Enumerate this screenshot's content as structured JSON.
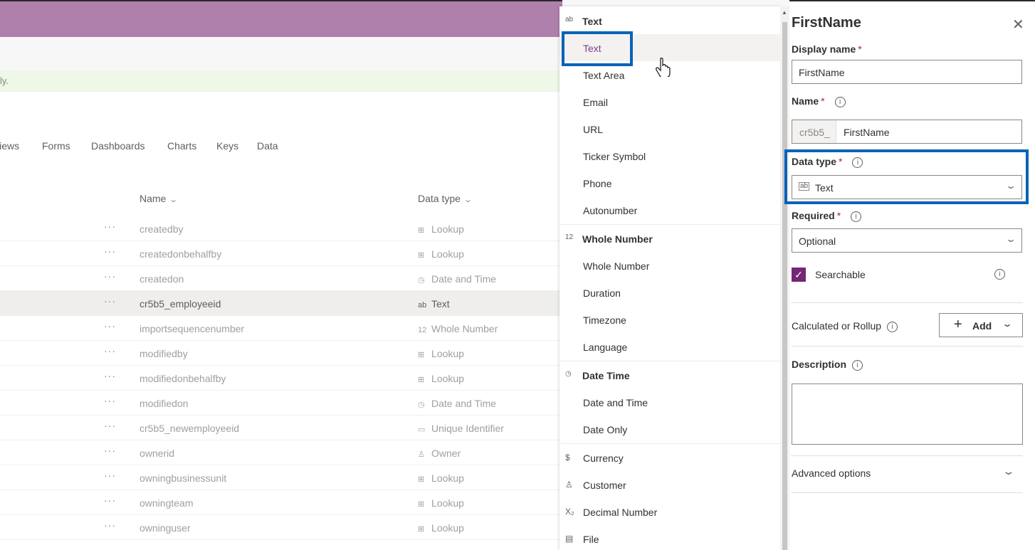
{
  "background": {
    "notice_text": "ly.",
    "tabs": [
      "Views",
      "Forms",
      "Dashboards",
      "Charts",
      "Keys",
      "Data"
    ],
    "columns": {
      "name": "Name",
      "data_type": "Data type"
    },
    "rows": [
      {
        "name": "createdby",
        "type": "Lookup",
        "icon": "lookup-icon"
      },
      {
        "name": "createdonbehalfby",
        "type": "Lookup",
        "icon": "lookup-icon"
      },
      {
        "name": "createdon",
        "type": "Date and Time",
        "icon": "datetime-icon"
      },
      {
        "name": "cr5b5_employeeid",
        "type": "Text",
        "icon": "text-icon"
      },
      {
        "name": "importsequencenumber",
        "type": "Whole Number",
        "icon": "number-icon"
      },
      {
        "name": "modifiedby",
        "type": "Lookup",
        "icon": "lookup-icon"
      },
      {
        "name": "modifiedonbehalfby",
        "type": "Lookup",
        "icon": "lookup-icon"
      },
      {
        "name": "modifiedon",
        "type": "Date and Time",
        "icon": "datetime-icon"
      },
      {
        "name": "cr5b5_newemployeeid",
        "type": "Unique Identifier",
        "icon": "uid-icon"
      },
      {
        "name": "ownerid",
        "type": "Owner",
        "icon": "person-icon"
      },
      {
        "name": "owningbusinessunit",
        "type": "Lookup",
        "icon": "lookup-icon"
      },
      {
        "name": "owningteam",
        "type": "Lookup",
        "icon": "lookup-icon"
      },
      {
        "name": "owninguser",
        "type": "Lookup",
        "icon": "lookup-icon"
      }
    ]
  },
  "dropdown": {
    "groups": [
      {
        "label": "Text",
        "icon": "text-icon",
        "options": [
          "Text",
          "Text Area",
          "Email",
          "URL",
          "Ticker Symbol",
          "Phone",
          "Autonumber"
        ]
      },
      {
        "label": "Whole Number",
        "icon": "number-icon",
        "options": [
          "Whole Number",
          "Duration",
          "Timezone",
          "Language"
        ]
      },
      {
        "label": "Date Time",
        "icon": "datetime-icon",
        "options": [
          "Date and Time",
          "Date Only"
        ]
      }
    ],
    "standalone": [
      {
        "label": "Currency",
        "icon": "currency-icon"
      },
      {
        "label": "Customer",
        "icon": "person-icon"
      },
      {
        "label": "Decimal Number",
        "icon": "decimal-icon"
      },
      {
        "label": "File",
        "icon": "file-icon"
      }
    ],
    "highlighted": "Text"
  },
  "panel": {
    "title": "FirstName",
    "display_name_label": "Display name",
    "display_name_value": "FirstName",
    "name_label": "Name",
    "name_prefix": "cr5b5_",
    "name_value": "FirstName",
    "data_type_label": "Data type",
    "data_type_value": "Text",
    "required_label": "Required",
    "required_value": "Optional",
    "searchable_label": "Searchable",
    "calculated_label": "Calculated or Rollup",
    "add_label": "Add",
    "description_label": "Description",
    "advanced_label": "Advanced options",
    "required_marker": "*",
    "info_glyph": "i"
  },
  "colors": {
    "accent": "#742774",
    "highlight_box": "#0a63b8",
    "header_band": "#b080ad"
  }
}
